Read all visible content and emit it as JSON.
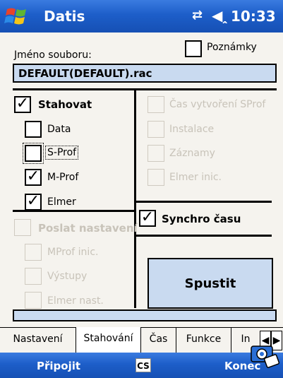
{
  "titlebar": {
    "app_title": "Datis",
    "time": "10:33",
    "icons": [
      "windows-flag-icon",
      "signal-icon",
      "volume-icon"
    ]
  },
  "file": {
    "label": "Jméno souboru:",
    "value": "DEFAULT(DEFAULT).rac"
  },
  "poznamky": {
    "label": "Poznámky",
    "checked": false
  },
  "stahovat": {
    "label": "Stahovat",
    "checked": true,
    "items": [
      {
        "label": "Data",
        "checked": false
      },
      {
        "label": "S-Prof",
        "checked": false
      },
      {
        "label": "M-Prof",
        "checked": true
      },
      {
        "label": "Elmer",
        "checked": true
      }
    ]
  },
  "poslat": {
    "label": "Poslat nastavení",
    "enabled": false,
    "items": [
      {
        "label": "MProf inic."
      },
      {
        "label": "Výstupy"
      },
      {
        "label": "Elmer nast."
      }
    ]
  },
  "right_options": [
    {
      "label": "Čas vytvoření SProf"
    },
    {
      "label": "Instalace"
    },
    {
      "label": "Záznamy"
    },
    {
      "label": "Elmer inic."
    }
  ],
  "synchro": {
    "label": "Synchro času",
    "checked": true
  },
  "spustit_label": "Spustit",
  "tabs": [
    {
      "label": "Nastavení",
      "active": false
    },
    {
      "label": "Stahování",
      "active": true
    },
    {
      "label": "Čas",
      "active": false
    },
    {
      "label": "Funkce",
      "active": false
    },
    {
      "label": "In",
      "active": false
    }
  ],
  "menubar": {
    "left": "Připojit",
    "lang": "CS",
    "right": "Konec"
  },
  "colors": {
    "title_bar": "#1d5ec9",
    "field_bg": "#c9daf0",
    "background": "#f5f3ee",
    "disabled_text": "#c8c3b9"
  }
}
